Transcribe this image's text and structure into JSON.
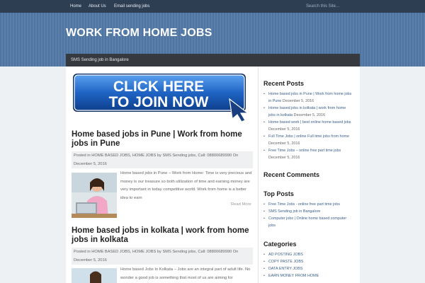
{
  "topnav": {
    "items": [
      "Home",
      "About Us",
      "Email sending jobs"
    ],
    "search_placeholder": "Search this Site..."
  },
  "site": {
    "title": "WORK FROM HOME JOBS",
    "subnav": "SMS Sending job in Bangalore"
  },
  "banner": {
    "line1": "CLICK HERE",
    "line2": "TO JOIN NOW"
  },
  "posts": [
    {
      "title_line1": "Home based jobs in Pune | Work from home",
      "title_line2": "jobs in Pune",
      "meta_line1": "Posted in HOME BASED JOBS, HOME JOBS by SMS Sending jobs, Call: 08800689990 On",
      "meta_line2": "December 5, 2016",
      "excerpt": "Home based jobs in Pune – Work from Home: Time is very precious and money is our treasure so both utilization of time and earning money are very important in today competitive world. Work from home is a better idea to earn",
      "read_more": "Read More"
    },
    {
      "title_line1": "Home based jobs in kolkata | work from home",
      "title_line2": "jobs in kolkata",
      "meta_line1": "Posted in HOME BASED JOBS, HOME JOBS by SMS Sending jobs, Call: 08800689990 On",
      "meta_line2": "December 5, 2016",
      "excerpt": "Home based Jobs In Kolkata – Jobs are an integral part of adult life. No wonder a good job is something that most of us are aiming for"
    }
  ],
  "sidebar": {
    "recent_posts_title": "Recent Posts",
    "recent_posts": [
      {
        "link_a": "Home based jobs in Pune | Work from home jobs",
        "link_b": "in Pune",
        "date": "December 5, 2016"
      },
      {
        "link_a": "Home based jobs in kolkata | work from home",
        "link_b": "jobs in kolkata",
        "date": "December 5, 2016"
      },
      {
        "link_a": "Home based work | best online home based jobs",
        "link_b": "",
        "date": "December 5, 2016"
      },
      {
        "link_a": "Full Time Jobs | online Full time jobs from home",
        "link_b": "",
        "date": "December 5, 2016"
      },
      {
        "link_a": "Free Time Jobs – online free part time jobs",
        "link_b": "",
        "date": "December 5, 2016"
      }
    ],
    "recent_comments_title": "Recent Comments",
    "top_posts_title": "Top Posts",
    "top_posts": [
      {
        "a": "Free Time Jobs - online free part time jobs",
        "b": ""
      },
      {
        "a": "SMS Sending job in Bangalore",
        "b": ""
      },
      {
        "a": "Computer jobs | Online home based computer",
        "b": "jobs"
      }
    ],
    "categories_title": "Categories",
    "categories": [
      "AD POSTING JOBS",
      "COPY PASTE JOBS",
      "DATA ENTRY JOBS",
      "EARN MONEY FROM HOME"
    ]
  },
  "colors": {
    "nav_bg": "#2d3e52",
    "header_blue": "#5278a5",
    "button_blue": "#1f64c4",
    "link": "#3a5f8a"
  }
}
